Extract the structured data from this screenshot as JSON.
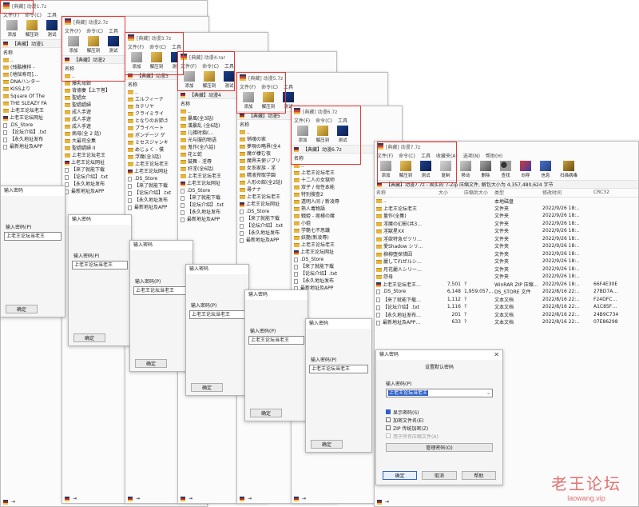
{
  "colors": {
    "highlight_box": "#e53935",
    "accent": "#2f61c8",
    "watermark": "#da4b4b"
  },
  "menu": {
    "file": "文件(F)",
    "cmd": "命令(C)",
    "tools": "工具",
    "fav": "收藏夹(A)",
    "options": "选项(N)",
    "help": "帮助(H)"
  },
  "toolbar": {
    "add": "添加",
    "extract": "解压到",
    "test": "测试",
    "copy": "复制",
    "move": "移动",
    "delete": "删除",
    "find": "查找",
    "wizard": "向导",
    "info": "信息",
    "scan": "扫描病毒"
  },
  "back_windows": [
    {
      "title": "[典藏] 动漫1.7z",
      "path": "【典藏】动漫1",
      "list": [
        "..",
        "(残酷模样 -",
        "[地狱寿司]…",
        "DNAハンター",
        "KISSより",
        "Square Of The",
        "THE SLEAZY FA",
        "上老王论坛老王",
        "上老王论坛网址",
        ".DS_Store",
        "【论坛介绍】.txt",
        "【永久地址发布",
        "最新地址及APP"
      ]
    },
    {
      "title": "[典藏] 动漫2.7z",
      "path": "【典藏】动漫2",
      "list": [
        "..",
        "爆乳母娘",
        "背德妻【上下巻】",
        "聖娼女",
        "聖娼娼婦",
        "成人手遊",
        "成人手遊",
        "成人手遊",
        "病母(全 2 話)",
        "大最司全集",
        "聖娼娼婦 II",
        "上老王论坛老王",
        "上老王论坛网址",
        "【来了就能下载",
        "【论坛介绍】.txt",
        "【永久地址发布",
        "最新地址及APP"
      ]
    },
    {
      "title": "[典藏] 动漫3.7z",
      "path": "【典藏】动漫3",
      "list": [
        "..",
        "エルフィーナ",
        "カテリヤ",
        "クライミライ",
        "となりのお姉さ",
        "プライベート",
        "ボンデージ ゲ",
        "ミセスジャンキ",
        "めじょく - 僕",
        "浮魔(全3話)",
        "上老王论坛老王",
        "上老王论坛网址",
        ".DS_Store",
        "【来了就能下载",
        "【论坛介绍】.txt",
        "【永久地址发布",
        "最新地址及APP"
      ]
    },
    {
      "title": "[典藏] 动漫4.rar",
      "path": "【典藏】动漫4",
      "list": [
        "..",
        "暴風(全3話)",
        "漢暴乱 (全6話)",
        "儿蜡时痴(…",
        "光与服的物语",
        "鬼作(全六話)",
        "花と蛇",
        "鼓舞 - 淫辱",
        "奸淫(全6話)",
        "上老王论坛老王",
        "上老王论坛网址",
        ".DS_Store",
        "【来了就能下载",
        "【论坛介绍】.txt",
        "【永久地址发布",
        "最新地址及APP"
      ]
    },
    {
      "title": "[典藏] 动漫5.7z",
      "path": "【典藏】动漫5",
      "list": [
        "..",
        "销魂の家",
        "夢現の略界(全4",
        "魔が棲む夜",
        "魔界天使ジブリ",
        "女系家族 - 淫",
        "精液搾取学園",
        "人形の館(全2話)",
        "尋ナナ",
        "上老王论坛老王",
        "上老王论坛网址",
        ".DS_Store",
        "【来了就能下载",
        "【论坛介绍】.txt",
        "【永久地址发布",
        "最新地址及APP"
      ]
    },
    {
      "title": "[典藏] 动漫6.7z",
      "path": "【典藏】动漫6.7z",
      "list": [
        "..",
        "上老王论坛老王",
        "十二人の女獄师",
        "双子 / 母性本能",
        "特别搜查2",
        "透明人间 / 新凌辱",
        "熟人毒物語",
        "戦姫 - 痙様の魔",
        "小姐",
        "学艶七不思議",
        "妖艶(新凌辱)",
        "上老王论坛老王",
        "上老王论坛网址",
        ".DS_Store",
        "【来了就能下载",
        "【论坛介绍】.txt",
        "【永久地址发布",
        "最新地址及APP"
      ],
      "sizes": [
        "7,501",
        "6,148",
        "1,112",
        "1,116",
        "201",
        "633"
      ]
    }
  ],
  "front": {
    "title": "[典藏] 动漫7.7z",
    "path": "【典藏】动漫7.7z - 固实的 7-Zip 压缩文件, 解包大小为 4,357,480,624 字节",
    "columns": [
      "名称",
      "大小",
      "压缩后大小",
      "类型",
      "修改时间",
      "CRC32"
    ],
    "rows": [
      {
        "name": "..",
        "size": "",
        "packed": "",
        "type": "本地磁盘",
        "mtime": "",
        "crc": ""
      },
      {
        "name": "上老王论坛老王",
        "size": "",
        "packed": "",
        "type": "文件夹",
        "mtime": "2022/9/26 18:..",
        "crc": ""
      },
      {
        "name": "量作(全集)",
        "size": "",
        "packed": "",
        "type": "文件夹",
        "mtime": "2022/9/26 18:..",
        "crc": ""
      },
      {
        "name": "淫魔の幻影(共3…",
        "size": "",
        "packed": "",
        "type": "文件夹",
        "mtime": "2022/9/26 18:..",
        "crc": ""
      },
      {
        "name": "淫獣星XX",
        "size": "",
        "packed": "",
        "type": "文件夹",
        "mtime": "2022/9/26 18:..",
        "crc": ""
      },
      {
        "name": "淫欲特急ゼツリ…",
        "size": "",
        "packed": "",
        "type": "文件夹",
        "mtime": "2022/9/26 18:..",
        "crc": ""
      },
      {
        "name": "愛Shadow シリ…",
        "size": "",
        "packed": "",
        "type": "文件夹",
        "mtime": "2022/9/26 18:..",
        "crc": ""
      },
      {
        "name": "柳柳堕探惜因",
        "size": "",
        "packed": "",
        "type": "文件夹",
        "mtime": "2022/9/26 18:..",
        "crc": ""
      },
      {
        "name": "麗してれぜルシ…",
        "size": "",
        "packed": "",
        "type": "文件夹",
        "mtime": "2022/9/26 18:..",
        "crc": ""
      },
      {
        "name": "月花麗人シリー…",
        "size": "",
        "packed": "",
        "type": "文件夹",
        "mtime": "2022/9/26 18:..",
        "crc": ""
      },
      {
        "name": "怨母",
        "size": "",
        "packed": "",
        "type": "文件夹",
        "mtime": "2022/9/26 18:..",
        "crc": ""
      },
      {
        "name": "上老王论坛老王…",
        "size": "7,501",
        "packed": "?",
        "type": "WinRAR ZIP 压缩…",
        "mtime": "2022/9/26 18:..",
        "crc": "66F4E30E"
      },
      {
        "name": ".DS_Store",
        "size": "6,148",
        "packed": "1,959,057,…",
        "type": "DS_STORE 文件",
        "mtime": "2022/8/16 22:..",
        "crc": "27BD7A…"
      },
      {
        "name": "【来了就能下载…",
        "size": "1,112",
        "packed": "?",
        "type": "文本文档",
        "mtime": "2022/8/16 22:..",
        "crc": "F24DFC…"
      },
      {
        "name": "【论坛介绍】.txt",
        "size": "1,116",
        "packed": "?",
        "type": "文本文档",
        "mtime": "2022/8/16 22:..",
        "crc": "A1C85F…"
      },
      {
        "name": "【永久地址发布…",
        "size": "201",
        "packed": "?",
        "type": "文本文档",
        "mtime": "2022/8/16 22:..",
        "crc": "24B9C734"
      },
      {
        "name": "最新地址及APP…",
        "size": "633",
        "packed": "?",
        "type": "文本文档",
        "mtime": "2022/8/16 22:..",
        "crc": "07E86298"
      }
    ]
  },
  "dialog": {
    "title": "输入密码",
    "close": "✕",
    "heading": "设置默认密码",
    "pw_label": "输入密码(P)",
    "pw_value": "上老王论坛当老王",
    "dropdown": "⌄",
    "show_pw": "显示密码(S)",
    "encrypt_names": "加密文件名(E)",
    "zip_legacy": "ZIP 传统加密(Z)",
    "all_archives": "用于所有压缩文件(A)",
    "manage": "管理密码(O)",
    "ok": "确定",
    "cancel": "取消",
    "help": "帮助"
  },
  "stacked_dialog_pw": "上老王论坛当老王",
  "watermark": {
    "line1": "老王论坛",
    "line2": "laowang.vip"
  }
}
